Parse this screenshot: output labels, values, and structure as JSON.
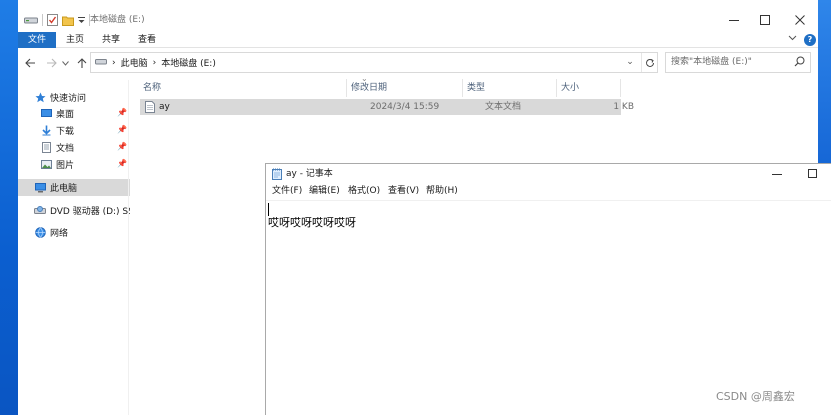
{
  "explorer": {
    "title": "本地磁盘 (E:)",
    "ribbon_tabs": [
      "文件",
      "主页",
      "共享",
      "查看"
    ],
    "address": {
      "root": "此电脑",
      "current": "本地磁盘 (E:)"
    },
    "search_placeholder": "搜索\"本地磁盘 (E:)\"",
    "nav": {
      "quick_access": "快速访问",
      "desktop": "桌面",
      "downloads": "下载",
      "documents": "文档",
      "pictures": "图片",
      "this_pc": "此电脑",
      "dvd": "DVD 驱动器 (D:) SSS",
      "network": "网络"
    },
    "columns": {
      "name": "名称",
      "date": "修改日期",
      "type": "类型",
      "size": "大小"
    },
    "files": [
      {
        "name": "ay",
        "date": "2024/3/4 15:59",
        "type": "文本文档",
        "size": "1 KB"
      }
    ]
  },
  "notepad": {
    "title": "ay - 记事本",
    "menus": [
      "文件(F)",
      "编辑(E)",
      "格式(O)",
      "查看(V)",
      "帮助(H)"
    ],
    "content": "哎呀哎呀哎呀哎呀"
  },
  "watermark": "CSDN @周鑫宏",
  "colors": {
    "accent": "#1f6fc5",
    "selection": "#d9d9d9",
    "desktop": "#0a64d4"
  }
}
